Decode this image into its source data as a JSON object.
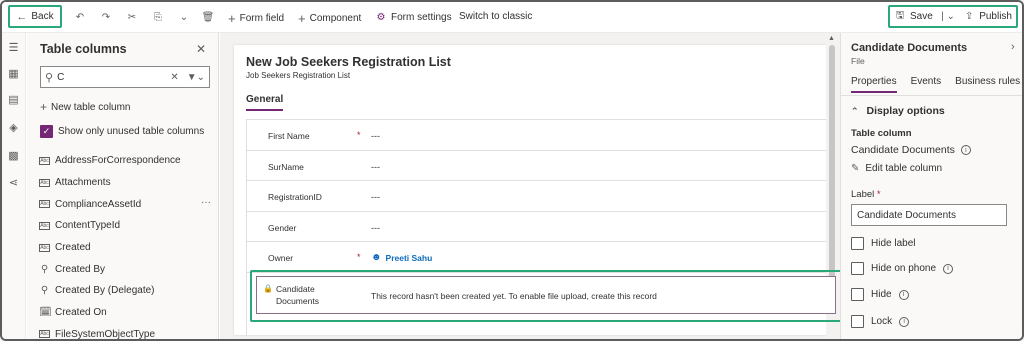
{
  "toolbar": {
    "back_label": "Back",
    "form_field_label": "Form field",
    "component_label": "Component",
    "form_settings_label": "Form settings",
    "switch_classic_label": "Switch to classic",
    "save_label": "Save",
    "publish_label": "Publish"
  },
  "columns_panel": {
    "title": "Table columns",
    "search_value": "C",
    "new_column_label": "New table column",
    "only_unused_label": "Show only unused table columns",
    "items": [
      {
        "label": "AddressForCorrespondence",
        "icon": "text-field-icon"
      },
      {
        "label": "Attachments",
        "icon": "text-field-icon"
      },
      {
        "label": "ComplianceAssetId",
        "icon": "text-field-icon"
      },
      {
        "label": "ContentTypeId",
        "icon": "text-field-icon"
      },
      {
        "label": "Created",
        "icon": "text-field-icon"
      },
      {
        "label": "Created By",
        "icon": "lookup-icon"
      },
      {
        "label": "Created By (Delegate)",
        "icon": "lookup-icon"
      },
      {
        "label": "Created On",
        "icon": "calendar-icon"
      },
      {
        "label": "FileSystemObjectType",
        "icon": "text-field-icon"
      }
    ]
  },
  "form": {
    "title": "New Job Seekers Registration List",
    "subtitle": "Job Seekers Registration List",
    "tab": "General",
    "fields": [
      {
        "label": "First Name",
        "required": "*",
        "value": "---"
      },
      {
        "label": "SurName",
        "required": "",
        "value": "---"
      },
      {
        "label": "RegistrationID",
        "required": "",
        "value": "---"
      },
      {
        "label": "Gender",
        "required": "",
        "value": "---"
      },
      {
        "label": "Owner",
        "required": "*",
        "value": "Preeti Sahu"
      }
    ],
    "candidate": {
      "label_line1": "Candidate",
      "label_line2": "Documents",
      "message": "This record hasn't been created yet. To enable file upload, create this record"
    }
  },
  "properties": {
    "title": "Candidate Documents",
    "subtitle": "File",
    "tabs": [
      "Properties",
      "Events",
      "Business rules"
    ],
    "display_options": "Display options",
    "table_column_label": "Table column",
    "table_column_value": "Candidate Documents",
    "edit_column": "Edit table column",
    "label_caption": "Label",
    "label_required": "*",
    "label_value": "Candidate Documents",
    "checks": [
      "Hide label",
      "Hide on phone",
      "Hide",
      "Lock"
    ]
  },
  "colors": {
    "accent": "#742774",
    "highlight": "#2aa87a",
    "link": "#0f6cbd"
  }
}
